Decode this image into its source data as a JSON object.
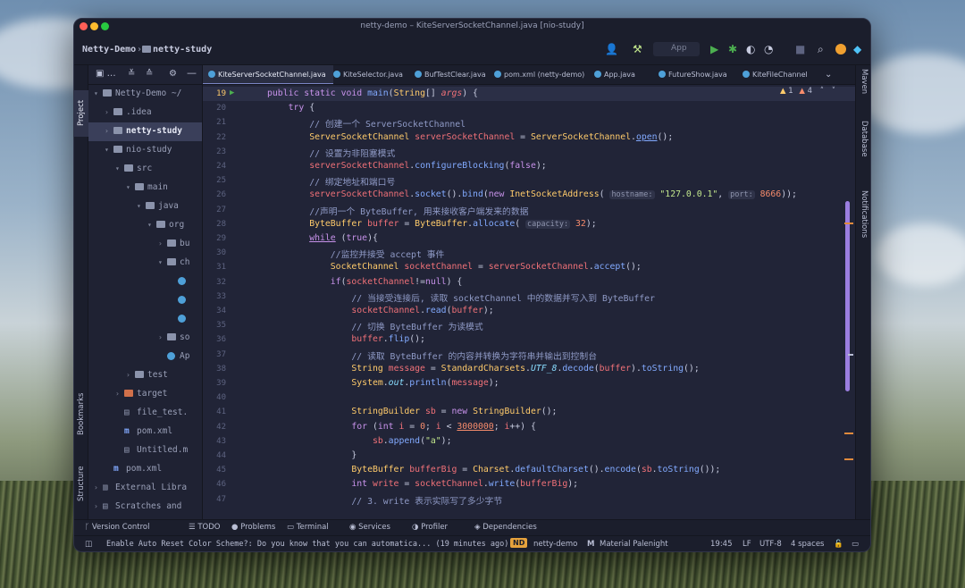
{
  "window": {
    "title": "netty-demo – KiteServerSocketChannel.java [nio-study]",
    "traffic_colors": [
      "#ff5f57",
      "#febc2e",
      "#28c840"
    ]
  },
  "navbar": {
    "crumb_project": "Netty-Demo",
    "crumb_module": "netty-study",
    "run_config": "App"
  },
  "left_tool": {
    "project_label": "Project",
    "bookmarks_label": "Bookmarks",
    "structure_label": "Structure"
  },
  "right_tool": {
    "maven_label": "Maven",
    "database_label": "Database",
    "notifications_label": "Notifications"
  },
  "project_tree": [
    {
      "label": "Netty-Demo ~/",
      "indent": 0,
      "arrow": "down",
      "icon": "folder"
    },
    {
      "label": ".idea",
      "indent": 1,
      "arrow": "right",
      "icon": "folder"
    },
    {
      "label": "netty-study",
      "indent": 1,
      "arrow": "right",
      "icon": "folder",
      "selected": true
    },
    {
      "label": "nio-study",
      "indent": 1,
      "arrow": "down",
      "icon": "folder"
    },
    {
      "label": "src",
      "indent": 2,
      "arrow": "down",
      "icon": "folder"
    },
    {
      "label": "main",
      "indent": 3,
      "arrow": "down",
      "icon": "folder"
    },
    {
      "label": "java",
      "indent": 4,
      "arrow": "down",
      "icon": "folder"
    },
    {
      "label": "org",
      "indent": 5,
      "arrow": "down",
      "icon": "folder"
    },
    {
      "label": "bu",
      "indent": 6,
      "arrow": "right",
      "icon": "folder"
    },
    {
      "label": "ch",
      "indent": 6,
      "arrow": "down",
      "icon": "folder"
    },
    {
      "label": "",
      "indent": 7,
      "arrow": "",
      "icon": "class"
    },
    {
      "label": "",
      "indent": 7,
      "arrow": "",
      "icon": "class"
    },
    {
      "label": "",
      "indent": 7,
      "arrow": "",
      "icon": "class"
    },
    {
      "label": "so",
      "indent": 6,
      "arrow": "right",
      "icon": "folder"
    },
    {
      "label": "Ap",
      "indent": 6,
      "arrow": "",
      "icon": "class"
    },
    {
      "label": "test",
      "indent": 3,
      "arrow": "right",
      "icon": "folder"
    },
    {
      "label": "target",
      "indent": 2,
      "arrow": "right",
      "icon": "folder-orange"
    },
    {
      "label": "file_test.",
      "indent": 2,
      "arrow": "",
      "icon": "file"
    },
    {
      "label": "pom.xml",
      "indent": 2,
      "arrow": "",
      "icon": "maven"
    },
    {
      "label": "Untitled.m",
      "indent": 2,
      "arrow": "",
      "icon": "file"
    },
    {
      "label": "pom.xml",
      "indent": 1,
      "arrow": "",
      "icon": "maven"
    },
    {
      "label": "External Libra",
      "indent": 0,
      "arrow": "right",
      "icon": "lib"
    },
    {
      "label": "Scratches and",
      "indent": 0,
      "arrow": "right",
      "icon": "scratch"
    }
  ],
  "tabs": [
    {
      "label": "KiteServerSocketChannel.java",
      "active": true
    },
    {
      "label": "KiteSelector.java"
    },
    {
      "label": "BufTestClear.java"
    },
    {
      "label": "pom.xml (netty-demo)"
    },
    {
      "label": "App.java"
    },
    {
      "label": "FutureShow.java"
    },
    {
      "label": "KiteFileChannel"
    }
  ],
  "inspections": {
    "warnings": "1",
    "weak_warnings": "4"
  },
  "code_lines": [
    {
      "n": "19",
      "html": "<span class=\"k\">public static void </span><span class=\"f\">main</span>(<span class=\"t\">String</span>[] <span class=\"v\"><i>args</i></span>) {"
    },
    {
      "n": "20",
      "html": "    <span class=\"k\">try</span> {"
    },
    {
      "n": "21",
      "html": "        <span class=\"c\">// 创建一个 ServerSocketChannel</span>"
    },
    {
      "n": "22",
      "html": "        <span class=\"t\">ServerSocketChannel</span> <span class=\"v\">serverSocketChannel</span> = <span class=\"t\">ServerSocketChannel</span>.<span class=\"f\"><u>open</u></span>();"
    },
    {
      "n": "23",
      "html": "        <span class=\"c\">// 设置为非阻塞模式</span>"
    },
    {
      "n": "24",
      "html": "        <span class=\"v\">serverSocketChannel</span>.<span class=\"f\">configureBlocking</span>(<span class=\"k\">false</span>);"
    },
    {
      "n": "25",
      "html": "        <span class=\"c\">// 绑定地址和端口号</span>"
    },
    {
      "n": "26",
      "html": "        <span class=\"v\">serverSocketChannel</span>.<span class=\"f\">socket</span>().<span class=\"f\">bind</span>(<span class=\"k\">new </span><span class=\"t\">InetSocketAddress</span>( <span class=\"hint\">hostname:</span> <span class=\"s\">\"127.0.0.1\"</span>, <span class=\"hint\">port:</span> <span class=\"n\">8666</span>));"
    },
    {
      "n": "27",
      "html": "        <span class=\"c\">//声明一个 ByteBuffer, 用来接收客户端发来的数据</span>"
    },
    {
      "n": "28",
      "html": "        <span class=\"t\">ByteBuffer</span> <span class=\"v\">buffer</span> = <span class=\"t\">ByteBuffer</span>.<span class=\"f\">allocate</span>( <span class=\"hint\">capacity:</span> <span class=\"n\">32</span>);"
    },
    {
      "n": "29",
      "html": "        <span class=\"k\"><u>while</u></span> (<span class=\"k\">true</span>){"
    },
    {
      "n": "30",
      "html": "            <span class=\"c\">//监控并接受 accept 事件</span>"
    },
    {
      "n": "31",
      "html": "            <span class=\"t\">SocketChannel</span> <span class=\"v\">socketChannel</span> = <span class=\"v\">serverSocketChannel</span>.<span class=\"f\">accept</span>();"
    },
    {
      "n": "32",
      "html": "            <span class=\"k\">if</span>(<span class=\"v\">socketChannel</span>!=<span class=\"k\">null</span>) {"
    },
    {
      "n": "33",
      "html": "                <span class=\"c\">// 当接受连接后, 读取 socketChannel 中的数据并写入到 ByteBuffer</span>"
    },
    {
      "n": "34",
      "html": "                <span class=\"v\">socketChannel</span>.<span class=\"f\">read</span>(<span class=\"v\">buffer</span>);"
    },
    {
      "n": "35",
      "html": "                <span class=\"c\">// 切换 ByteBuffer 为读模式</span>"
    },
    {
      "n": "36",
      "html": "                <span class=\"v\">buffer</span>.<span class=\"f\">flip</span>();"
    },
    {
      "n": "37",
      "html": "                <span class=\"c\">// 读取 ByteBuffer 的内容并转换为字符串并输出到控制台</span>"
    },
    {
      "n": "38",
      "html": "                <span class=\"t\">String</span> <span class=\"v\">message</span> = <span class=\"t\">StandardCharsets</span>.<span class=\"p\"><i>UTF_8</i></span>.<span class=\"f\">decode</span>(<span class=\"v\">buffer</span>).<span class=\"f\">toString</span>();"
    },
    {
      "n": "39",
      "html": "                <span class=\"t\">System</span>.<span class=\"p\"><i>out</i></span>.<span class=\"f\">println</span>(<span class=\"v\">message</span>);"
    },
    {
      "n": "40",
      "html": ""
    },
    {
      "n": "41",
      "html": "                <span class=\"t\">StringBuilder</span> <span class=\"v\">sb</span> = <span class=\"k\">new </span><span class=\"t\">StringBuilder</span>();"
    },
    {
      "n": "42",
      "html": "                <span class=\"k\">for </span>(<span class=\"k\">int </span><span class=\"v\">i</span> = <span class=\"n\">0</span>; <span class=\"v\">i</span> &lt; <span class=\"n\"><u>3000000</u></span>; <span class=\"v\">i</span>++) {"
    },
    {
      "n": "43",
      "html": "                    <span class=\"v\">sb</span>.<span class=\"f\">append</span>(<span class=\"s\">\"a\"</span>);"
    },
    {
      "n": "44",
      "html": "                }"
    },
    {
      "n": "45",
      "html": "                <span class=\"t\">ByteBuffer</span> <span class=\"v\">bufferBig</span> = <span class=\"t\">Charset</span>.<span class=\"f\">defaultCharset</span>().<span class=\"f\">encode</span>(<span class=\"v\">sb</span>.<span class=\"f\">toString</span>());"
    },
    {
      "n": "46",
      "html": "                <span class=\"k\">int </span><span class=\"v\">write</span> = <span class=\"v\">socketChannel</span>.<span class=\"f\">write</span>(<span class=\"v\">bufferBig</span>);"
    },
    {
      "n": "47",
      "html": "                <span class=\"c\">// 3. write 表示实际写了多少字节</span>"
    }
  ],
  "bottom_tools": [
    {
      "label": "Version Control",
      "icon": "branch-icon"
    },
    {
      "label": "TODO",
      "icon": "list-icon"
    },
    {
      "label": "Problems",
      "icon": "warning-icon"
    },
    {
      "label": "Terminal",
      "icon": "terminal-icon"
    },
    {
      "label": "Services",
      "icon": "services-icon"
    },
    {
      "label": "Profiler",
      "icon": "profiler-icon"
    },
    {
      "label": "Dependencies",
      "icon": "dependencies-icon"
    }
  ],
  "status": {
    "message": "Enable Auto Reset Color Scheme?: Do you know that you can automatica... (19 minutes ago)",
    "badge": "ND",
    "project": "netty-demo",
    "theme": "Material Palenight",
    "position": "19:45",
    "line_sep": "LF",
    "encoding": "UTF-8",
    "indent": "4 spaces"
  }
}
